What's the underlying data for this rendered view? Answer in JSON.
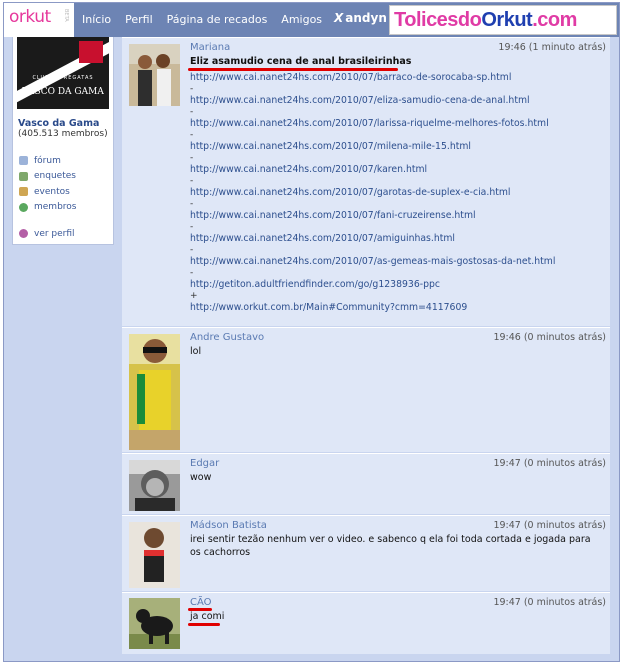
{
  "topbar": {
    "logo": "orkut",
    "beta": "BETA",
    "nav": [
      "Início",
      "Perfil",
      "Página de recados",
      "Amigos"
    ],
    "user": "andyn",
    "watermark_a": "Tolicesdo",
    "watermark_b": "Orkut",
    "watermark_c": ".com"
  },
  "sidebar": {
    "logo_line1": "CLUB DE REGATAS",
    "logo_line2": "VASCO DA GAMA",
    "community_name": "Vasco da Gama",
    "member_count": "(405.513 membros)",
    "menu": [
      "fórum",
      "enquetes",
      "eventos",
      "membros"
    ],
    "view_profile": "ver perfil"
  },
  "messages": [
    {
      "author": "Mariana",
      "time": "19:46 (1 minuto atrás)",
      "title": "Eliz asamudio cena de anal brasileirinhas",
      "links": [
        "http://www.cai.nanet24hs.com/2010/07/barraco-de-sorocaba-sp.html",
        "http://www.cai.nanet24hs.com/2010/07/eliza-samudio-cena-de-anal.html",
        "http://www.cai.nanet24hs.com/2010/07/larissa-riquelme-melhores-fotos.html",
        "http://www.cai.nanet24hs.com/2010/07/milena-mile-15.html",
        "http://www.cai.nanet24hs.com/2010/07/karen.html",
        "http://www.cai.nanet24hs.com/2010/07/garotas-de-suplex-e-cia.html",
        "http://www.cai.nanet24hs.com/2010/07/fani-cruzeirense.html",
        "http://www.cai.nanet24hs.com/2010/07/amiguinhas.html",
        "http://www.cai.nanet24hs.com/2010/07/as-gemeas-mais-gostosas-da-net.html",
        "http://getiton.adultfriendfinder.com/go/g1238936-ppc",
        "http://www.orkut.com.br/Main#Community?cmm=4117609"
      ],
      "separators": [
        "-",
        "-",
        "-",
        "-",
        "-",
        "-",
        "-",
        "-",
        "-",
        "+"
      ]
    },
    {
      "author": "Andre Gustavo",
      "time": "19:46 (0 minutos atrás)",
      "text": "lol"
    },
    {
      "author": "Edgar",
      "time": "19:47 (0 minutos atrás)",
      "text": "wow"
    },
    {
      "author": "Mádson Batista",
      "time": "19:47 (0 minutos atrás)",
      "text": "irei sentir tezão nenhum ver o video. e sabenco q ela foi toda cortada e jogada para os cachorros"
    },
    {
      "author": "CÃO",
      "time": "19:47 (0 minutos atrás)",
      "text": "ja comi"
    }
  ],
  "colors": {
    "nav_bar": "#6d84b4",
    "orkut_pink": "#e6389c",
    "highlight_red": "#e00000"
  }
}
